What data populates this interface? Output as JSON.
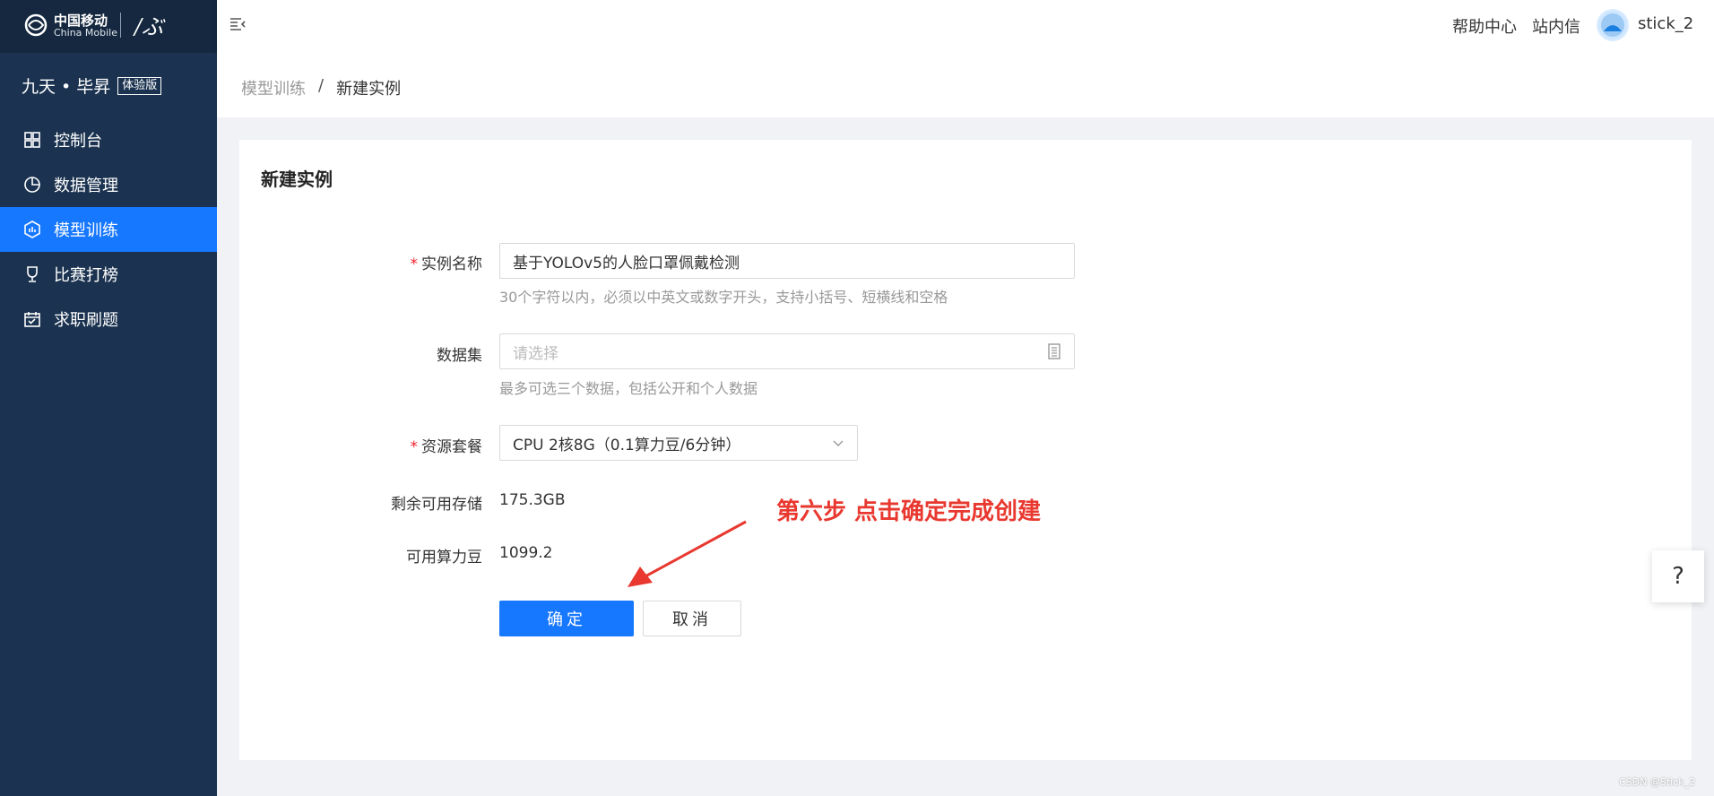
{
  "logo": {
    "cn": "中国移动",
    "en": "China Mobile",
    "sign": "/ぶ"
  },
  "brand": {
    "name": "九天 • 毕昇",
    "badge": "体验版"
  },
  "sidebar": {
    "items": [
      {
        "label": "控制台",
        "icon": "grid-icon",
        "active": false
      },
      {
        "label": "数据管理",
        "icon": "pie-chart-icon",
        "active": false
      },
      {
        "label": "模型训练",
        "icon": "model-training-icon",
        "active": true
      },
      {
        "label": "比赛打榜",
        "icon": "trophy-icon",
        "active": false
      },
      {
        "label": "求职刷题",
        "icon": "calendar-icon",
        "active": false
      }
    ]
  },
  "header": {
    "help": "帮助中心",
    "inbox": "站内信",
    "username": "stick_2"
  },
  "breadcrumb": {
    "parent": "模型训练",
    "sep": "/",
    "current": "新建实例"
  },
  "form": {
    "title": "新建实例",
    "instance_name": {
      "label": "实例名称",
      "value": "基于YOLOv5的人脸口罩佩戴检测",
      "help": "30个字符以内，必须以中英文或数字开头，支持小括号、短横线和空格"
    },
    "dataset": {
      "label": "数据集",
      "placeholder": "请选择",
      "help": "最多可选三个数据，包括公开和个人数据"
    },
    "resource": {
      "label": "资源套餐",
      "value": "CPU 2核8G（0.1算力豆/6分钟）"
    },
    "storage": {
      "label": "剩余可用存储",
      "value": "175.3GB"
    },
    "beans": {
      "label": "可用算力豆",
      "value": "1099.2"
    },
    "confirm": "确定",
    "cancel": "取消"
  },
  "annotation": "第六步 点击确定完成创建",
  "float_help": "?",
  "watermark": "CSDN @Stick_2",
  "colors": {
    "sidebar": "#1b3350",
    "accent": "#1677ff",
    "annotation": "#e8382f"
  }
}
